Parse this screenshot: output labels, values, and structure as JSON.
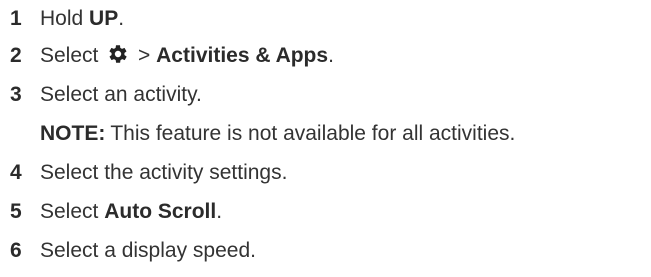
{
  "steps": [
    {
      "number": "1",
      "parts": [
        "Hold ",
        "UP",
        "."
      ]
    },
    {
      "number": "2",
      "parts": [
        "Select ",
        " > ",
        "Activities & Apps",
        "."
      ],
      "icon": "gear-icon"
    },
    {
      "number": "3",
      "parts": [
        "Select an activity."
      ]
    },
    {
      "note_label": "NOTE:",
      "note_text": "This feature is not available for all activities."
    },
    {
      "number": "4",
      "parts": [
        "Select the activity settings."
      ]
    },
    {
      "number": "5",
      "parts": [
        "Select ",
        "Auto Scroll",
        "."
      ]
    },
    {
      "number": "6",
      "parts": [
        "Select a display speed."
      ]
    }
  ],
  "colors": {
    "text": "#333333",
    "bold": "#2b2b2b"
  }
}
